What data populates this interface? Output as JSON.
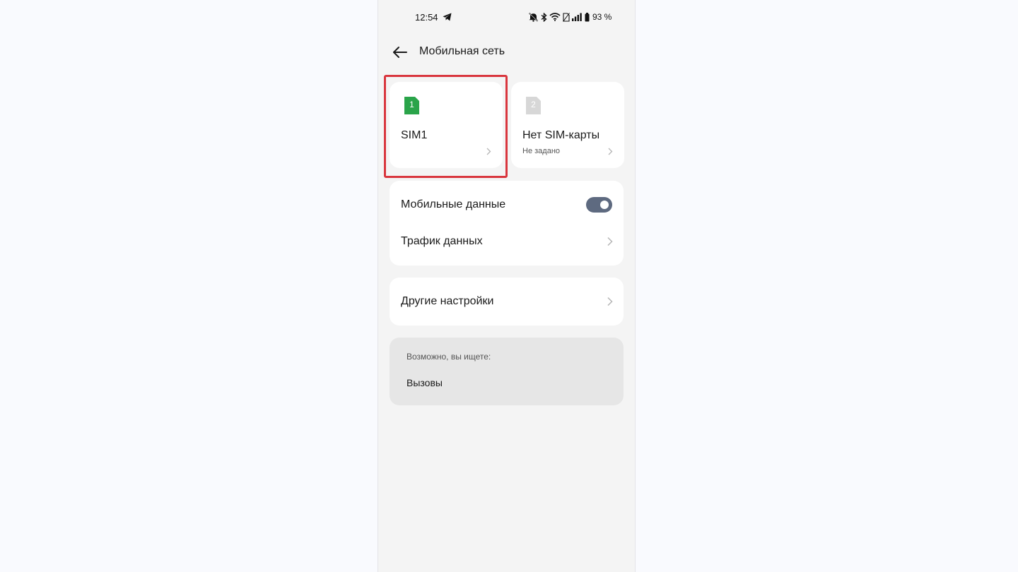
{
  "status_bar": {
    "time": "12:54",
    "battery": "93 %",
    "icons": [
      "telegram-icon",
      "mute-icon",
      "bluetooth-icon",
      "wifi-icon",
      "no-sim-icon",
      "signal-icon",
      "battery-icon"
    ]
  },
  "header": {
    "title": "Мобильная сеть",
    "back_icon": "arrow-left-icon"
  },
  "sims": [
    {
      "badge": "1",
      "name": "SIM1",
      "status": "",
      "color": "#2aa44a",
      "highlighted": true
    },
    {
      "badge": "2",
      "name": "Нет SIM-карты",
      "status": "Не задано",
      "color": "#d7d7d7",
      "highlighted": false
    }
  ],
  "data_card": {
    "mobile_data_label": "Мобильные данные",
    "mobile_data_enabled": true,
    "traffic_label": "Трафик данных"
  },
  "other_card": {
    "label": "Другие настройки"
  },
  "suggestions": {
    "caption": "Возможно, вы ищете:",
    "items": [
      "Вызовы"
    ]
  },
  "colors": {
    "highlight": "#d9363e",
    "toggle_on": "#5e6a80",
    "screen_bg": "#f4f4f4",
    "card_bg": "#ffffff"
  }
}
